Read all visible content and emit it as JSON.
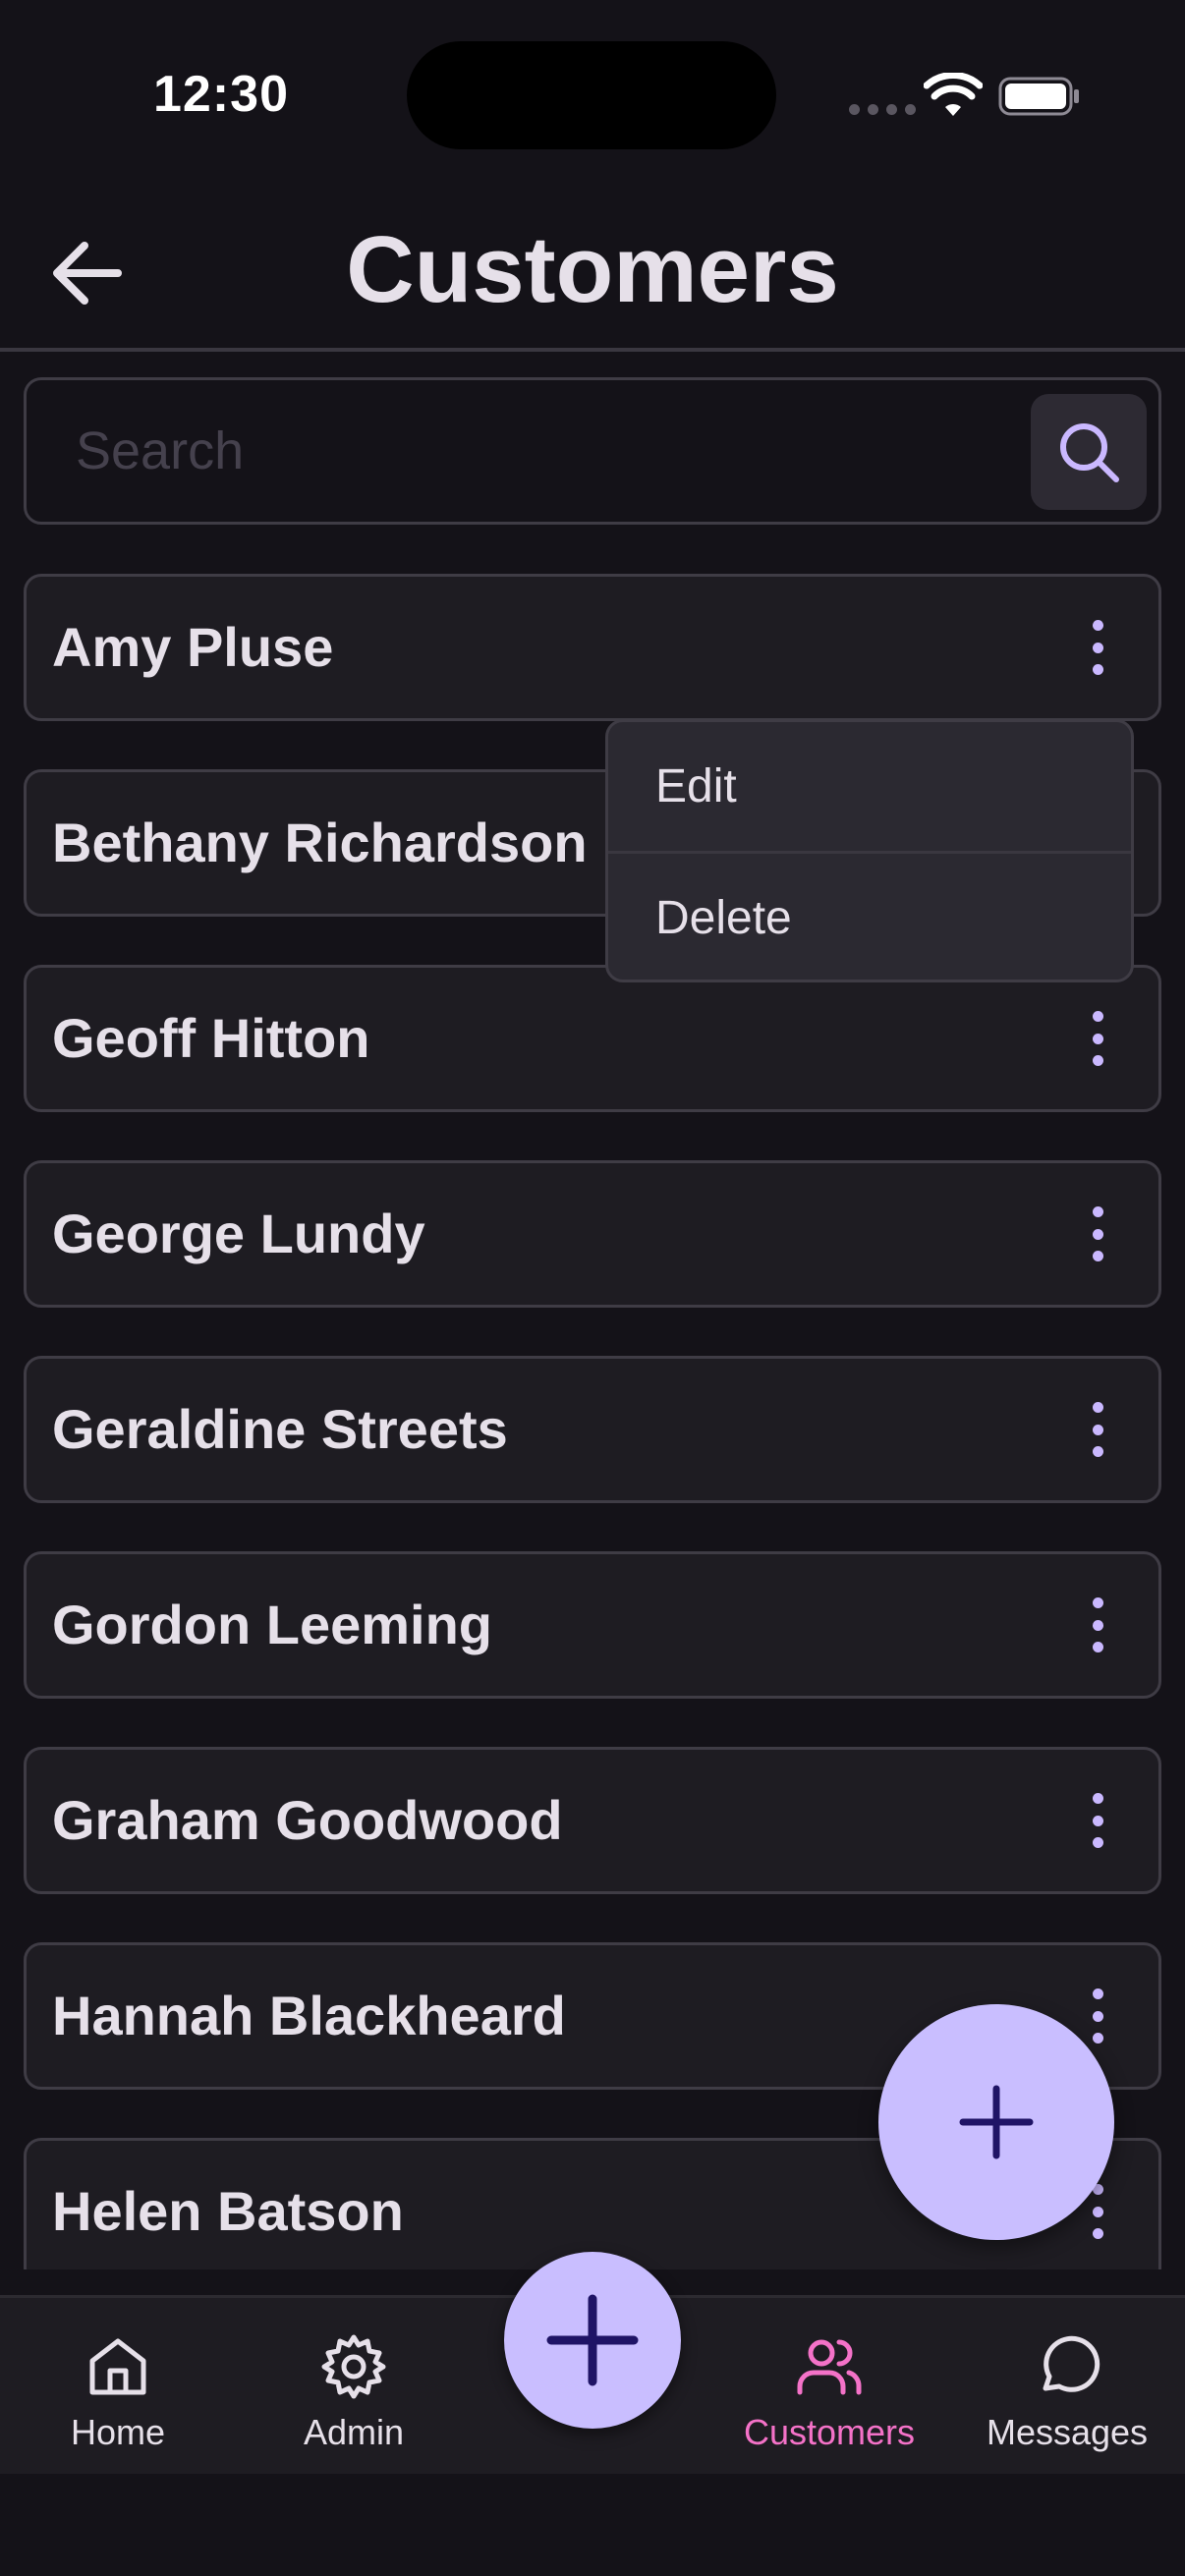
{
  "status_bar": {
    "time": "12:30"
  },
  "header": {
    "title": "Customers",
    "back_icon": "arrow-left-icon"
  },
  "search": {
    "placeholder": "Search",
    "value": "",
    "icon": "search-icon"
  },
  "customers": [
    {
      "name": "Amy Pluse"
    },
    {
      "name": "Bethany Richardson"
    },
    {
      "name": "Geoff Hitton"
    },
    {
      "name": "George Lundy"
    },
    {
      "name": "Geraldine Streets"
    },
    {
      "name": "Gordon Leeming"
    },
    {
      "name": "Graham Goodwood"
    },
    {
      "name": "Hannah Blackheard"
    },
    {
      "name": "Helen Batson"
    }
  ],
  "context_menu": {
    "items": [
      {
        "label": "Edit"
      },
      {
        "label": "Delete"
      }
    ]
  },
  "fab": {
    "icon": "plus-icon"
  },
  "bottom_nav": {
    "items": [
      {
        "label": "Home",
        "icon": "home-icon",
        "active": false
      },
      {
        "label": "Admin",
        "icon": "gear-icon",
        "active": false
      },
      {
        "label": "Customers",
        "icon": "users-icon",
        "active": true
      },
      {
        "label": "Messages",
        "icon": "message-circle-icon",
        "active": false
      }
    ],
    "center_icon": "plus-icon"
  },
  "colors": {
    "background": "#141218",
    "surface": "#1E1C22",
    "accent": "#C9BEFF",
    "accent_dark": "#1F1466",
    "active_nav": "#F472C8",
    "text": "#E6E0E9"
  }
}
